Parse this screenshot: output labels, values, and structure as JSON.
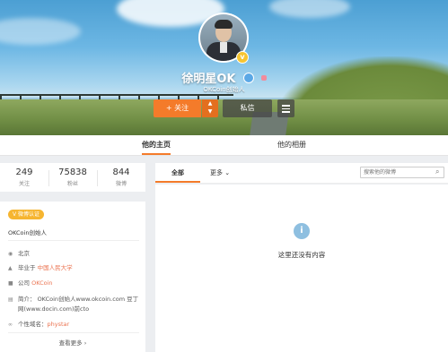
{
  "profile": {
    "name": "徐明星OK",
    "description": "OKCoin创始人"
  },
  "actions": {
    "follow_label": "+ 关注",
    "message_label": "私信"
  },
  "tabs": [
    {
      "label": "他的主页",
      "active": true
    },
    {
      "label": "他的相册",
      "active": false
    }
  ],
  "stats": [
    {
      "value": "249",
      "label": "关注"
    },
    {
      "value": "75838",
      "label": "粉丝"
    },
    {
      "value": "844",
      "label": "微博"
    }
  ],
  "info": {
    "verify_badge": "V 微博认证",
    "verify_text": "OKCoin创始人",
    "location": "北京",
    "education_prefix": "毕业于 ",
    "education_link": "中国人民大学",
    "company_prefix": "公司 ",
    "company_link": "OKCoin",
    "bio_line1": "简介： OKCoin创始人www.okcoin.com 豆丁",
    "bio_line2": "网(www.docin.com)前cto",
    "domain_prefix": "个性域名：",
    "domain_link": "phystar",
    "more": "查看更多 ›"
  },
  "feed": {
    "tab_all": "全部",
    "tab_more": "更多 ⌄",
    "search_placeholder": "搜索他的微博",
    "empty_text": "这里还没有内容"
  },
  "colors": {
    "accent": "#f47b2a",
    "link": "#eb7350",
    "verify": "#f6b530"
  }
}
